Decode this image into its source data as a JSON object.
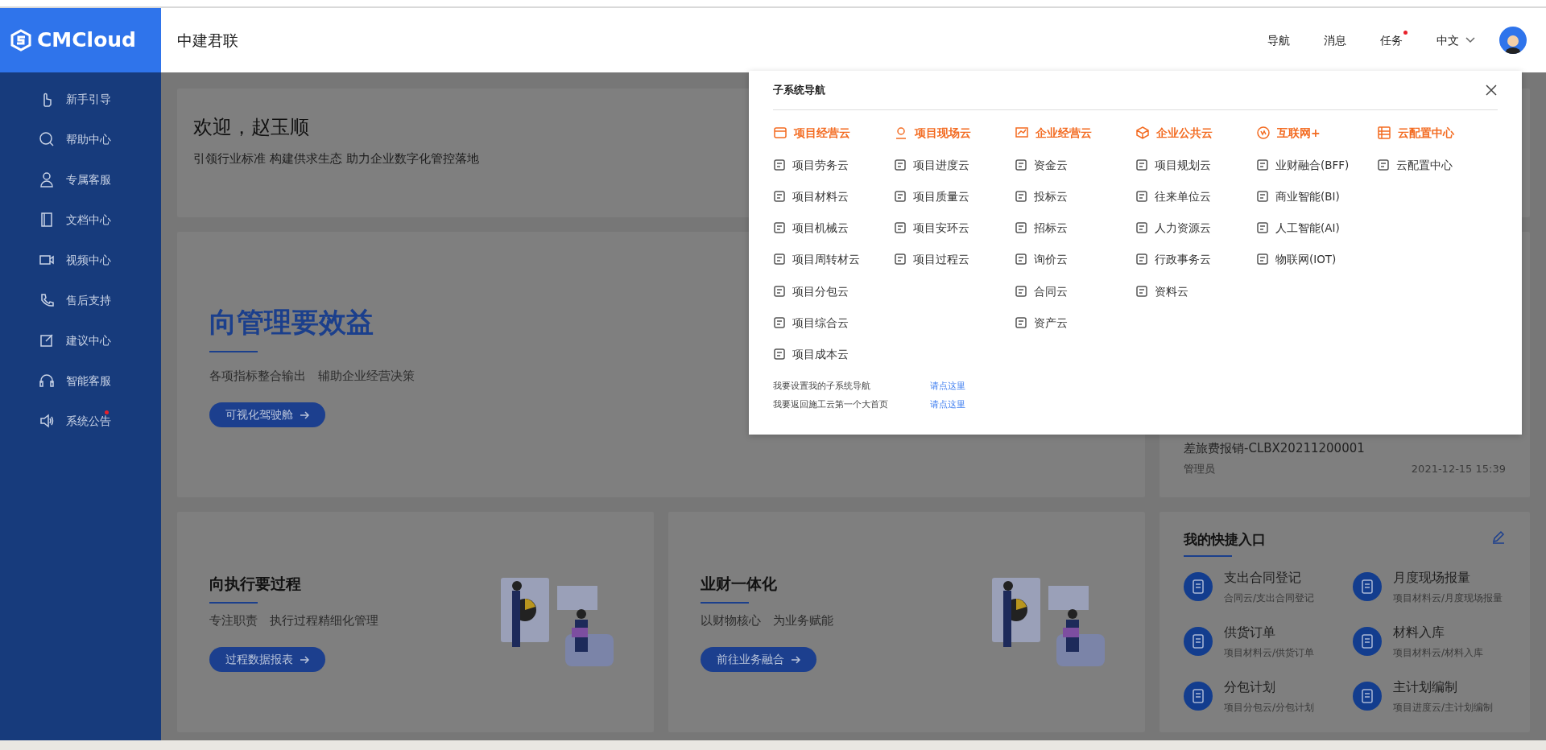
{
  "logo": "CMCloud",
  "header": {
    "title": "中建君联",
    "links": [
      {
        "label": "导航",
        "dot": false
      },
      {
        "label": "消息",
        "dot": false
      },
      {
        "label": "任务",
        "dot": true
      }
    ],
    "language": "中文"
  },
  "sidebar": {
    "items": [
      {
        "label": "新手引导",
        "dot": false
      },
      {
        "label": "帮助中心",
        "dot": false
      },
      {
        "label": "专属客服",
        "dot": false
      },
      {
        "label": "文档中心",
        "dot": false
      },
      {
        "label": "视频中心",
        "dot": false
      },
      {
        "label": "售后支持",
        "dot": false
      },
      {
        "label": "建议中心",
        "dot": false
      },
      {
        "label": "智能客服",
        "dot": false
      },
      {
        "label": "系统公告",
        "dot": true
      }
    ]
  },
  "welcome": {
    "title": "欢迎，赵玉顺",
    "subtitle": "引领行业标准 构建供求生态 助力企业数字化管控落地"
  },
  "hero": {
    "title": "向管理要效益",
    "subtitle": "各项指标整合输出　辅助企业经营决策",
    "button": "可视化驾驶舱"
  },
  "cards": [
    {
      "title": "向执行要过程",
      "subtitle": "专注职责　执行过程精细化管理",
      "button": "过程数据报表"
    },
    {
      "title": "业财一体化",
      "subtitle": "以财物核心　为业务赋能",
      "button": "前往业务融合"
    }
  ],
  "record": {
    "title": "差旅费报销-CLBX20211200001",
    "user": "管理员",
    "time": "2021-12-15 15:39"
  },
  "shortcuts": {
    "title": "我的快捷入口",
    "items": [
      {
        "title": "支出合同登记",
        "path": "合同云/支出合同登记"
      },
      {
        "title": "月度现场报量",
        "path": "项目材料云/月度现场报量"
      },
      {
        "title": "供货订单",
        "path": "项目材料云/供货订单"
      },
      {
        "title": "材料入库",
        "path": "项目材料云/材料入库"
      },
      {
        "title": "分包计划",
        "path": "项目分包云/分包计划"
      },
      {
        "title": "主计划编制",
        "path": "项目进度云/主计划编制"
      }
    ]
  },
  "subsystem_nav": {
    "title": "子系统导航",
    "groups": [
      {
        "title": "项目经营云",
        "items": [
          "项目劳务云",
          "项目材料云",
          "项目机械云",
          "项目周转材云",
          "项目分包云",
          "项目综合云",
          "项目成本云"
        ]
      },
      {
        "title": "项目现场云",
        "items": [
          "项目进度云",
          "项目质量云",
          "项目安环云",
          "项目过程云"
        ]
      },
      {
        "title": "企业经营云",
        "items": [
          "资金云",
          "投标云",
          "招标云",
          "询价云",
          "合同云",
          "资产云"
        ]
      },
      {
        "title": "企业公共云",
        "items": [
          "项目规划云",
          "往来单位云",
          "人力资源云",
          "行政事务云",
          "资料云"
        ]
      },
      {
        "title": "互联网+",
        "items": [
          "业财融合(BFF)",
          "商业智能(BI)",
          "人工智能(AI)",
          "物联网(IOT)"
        ]
      },
      {
        "title": "云配置中心",
        "items": [
          "云配置中心"
        ]
      }
    ],
    "footer": [
      {
        "text": "我要设置我的子系统导航",
        "link": "请点这里"
      },
      {
        "text": "我要返回施工云第一个大首页",
        "link": "请点这里"
      }
    ]
  }
}
